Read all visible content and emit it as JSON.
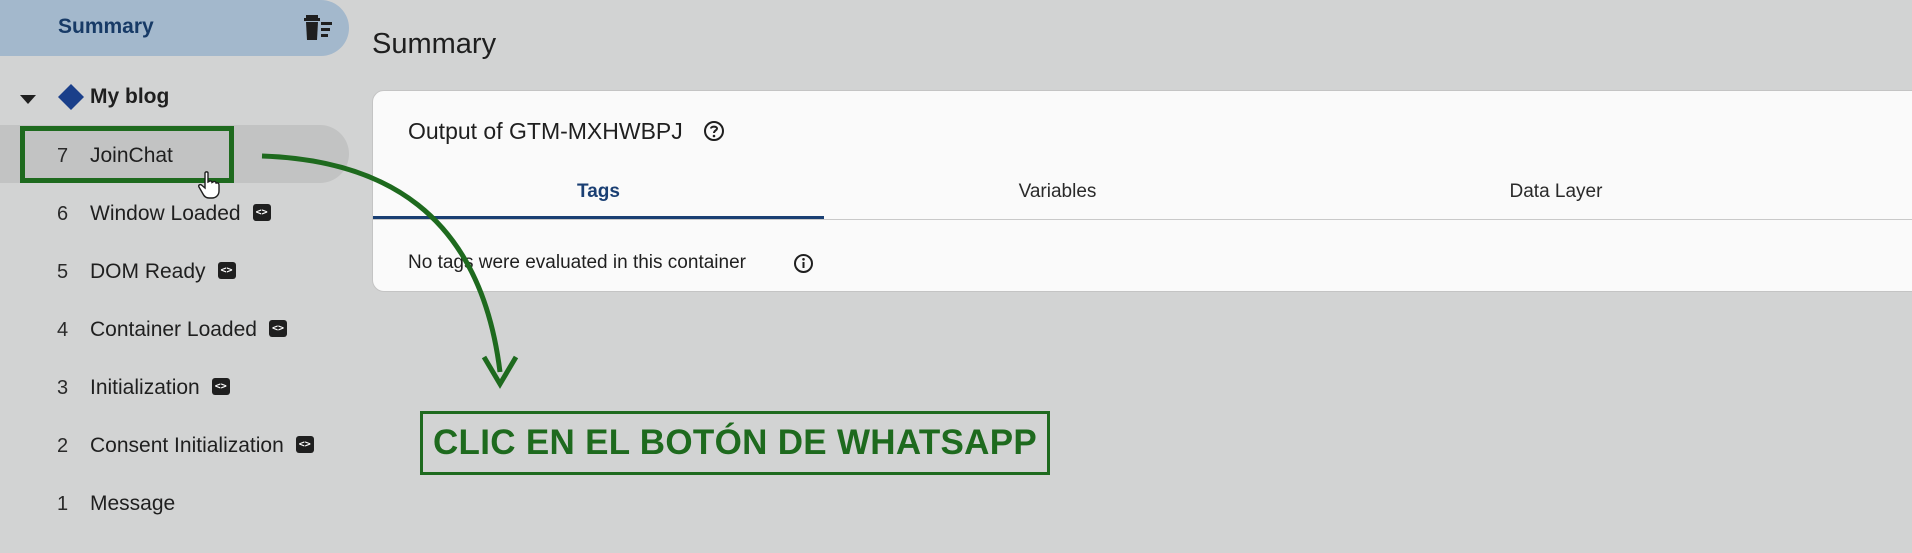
{
  "sidebar": {
    "summary_label": "Summary",
    "container_name": "My blog",
    "events": [
      {
        "num": "7",
        "label": "JoinChat",
        "code": false
      },
      {
        "num": "6",
        "label": "Window Loaded",
        "code": true
      },
      {
        "num": "5",
        "label": "DOM Ready",
        "code": true
      },
      {
        "num": "4",
        "label": "Container Loaded",
        "code": true
      },
      {
        "num": "3",
        "label": "Initialization",
        "code": true
      },
      {
        "num": "2",
        "label": "Consent Initialization",
        "code": true
      },
      {
        "num": "1",
        "label": "Message",
        "code": false
      }
    ]
  },
  "main": {
    "title": "Summary",
    "card_title": "Output of GTM-MXHWBPJ",
    "tabs": [
      {
        "label": "Tags"
      },
      {
        "label": "Variables"
      },
      {
        "label": "Data Layer"
      }
    ],
    "empty_message": "No tags were evaluated in this container"
  },
  "annotation": {
    "callout_text": "CLIC EN EL BOTÓN DE WHATSAPP"
  },
  "icons": {
    "trash": "trash-icon",
    "caret": "caret-down-icon",
    "container": "diamond-icon",
    "code": "code-badge-icon",
    "help": "help-icon",
    "info": "info-icon",
    "cursor": "hand-cursor-icon"
  },
  "colors": {
    "accent": "#1a3f73",
    "annotation": "#1e6a1e",
    "summary_pill": "#a3b8cc",
    "container_icon": "#1a3f8a"
  }
}
